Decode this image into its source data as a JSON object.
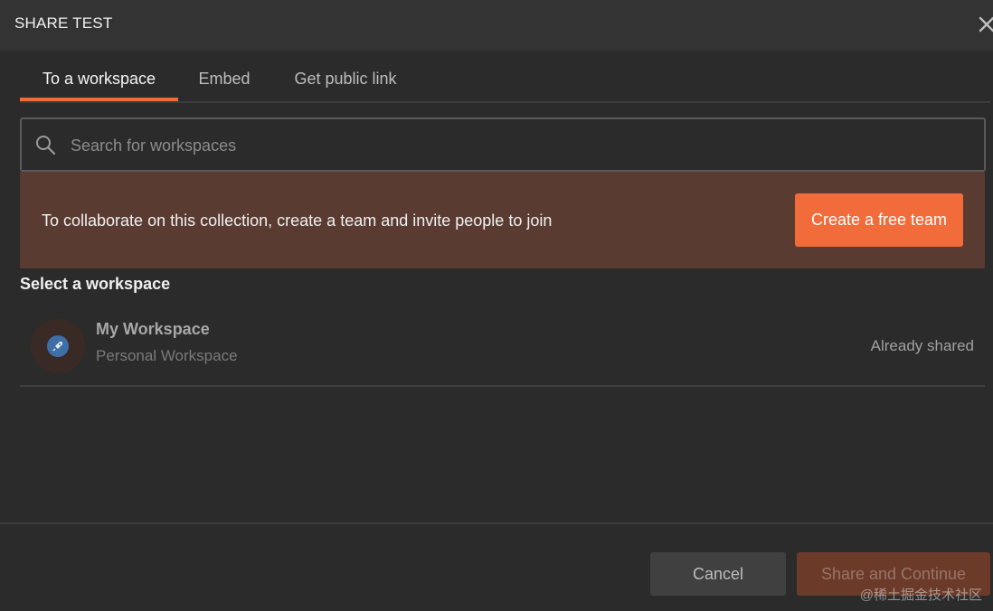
{
  "modal": {
    "title": "SHARE TEST",
    "close_icon": "close-icon"
  },
  "tabs": [
    {
      "label": "To a workspace",
      "active": true
    },
    {
      "label": "Embed",
      "active": false
    },
    {
      "label": "Get public link",
      "active": false
    }
  ],
  "search": {
    "placeholder": "Search for workspaces",
    "value": "",
    "icon": "search-icon"
  },
  "banner": {
    "text": "To collaborate on this collection, create a team and invite people to join",
    "button_label": "Create a free team"
  },
  "workspaces": {
    "section_title": "Select a workspace",
    "items": [
      {
        "name": "My Workspace",
        "type": "Personal Workspace",
        "status": "Already shared",
        "icon": "rocket-icon"
      }
    ]
  },
  "footer": {
    "cancel_label": "Cancel",
    "share_label": "Share and Continue"
  },
  "watermark": "@稀土掘金技术社区",
  "colors": {
    "accent": "#f26b3a",
    "banner_bg": "#5a3b31",
    "background": "#2b2b2b"
  }
}
